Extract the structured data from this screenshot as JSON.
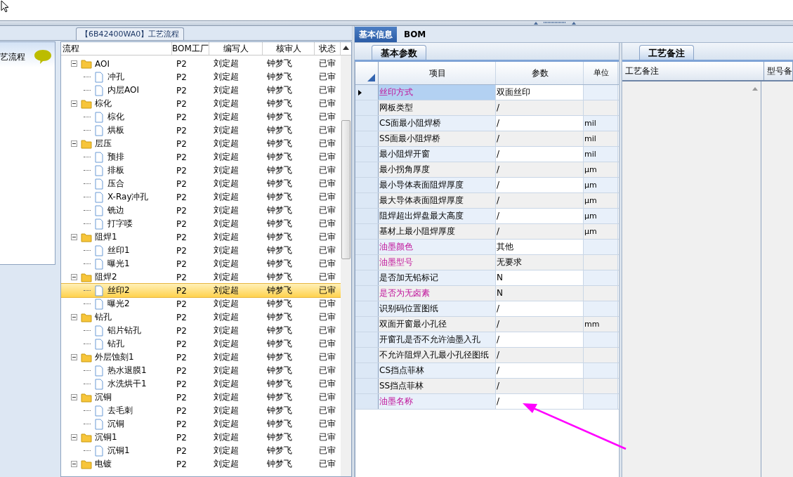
{
  "side_panel": {
    "title": "艺流程"
  },
  "process_tree": {
    "title": "【6B42400WA0】工艺流程",
    "columns": [
      "流程",
      "BOM工厂",
      "编写人",
      "核审人",
      "状态"
    ],
    "rows": [
      {
        "name": "AOI",
        "kind": "folder",
        "expanded": true,
        "bom_factory": "P2",
        "writer": "刘定超",
        "reviewer": "钟梦飞",
        "status": "已审",
        "selected": false,
        "children": [
          {
            "name": "冲孔",
            "kind": "file",
            "bom_factory": "P2",
            "writer": "刘定超",
            "reviewer": "钟梦飞",
            "status": "已审",
            "selected": false
          },
          {
            "name": "内层AOI",
            "kind": "file",
            "bom_factory": "P2",
            "writer": "刘定超",
            "reviewer": "钟梦飞",
            "status": "已审",
            "selected": false
          }
        ]
      },
      {
        "name": "棕化",
        "kind": "folder",
        "expanded": true,
        "bom_factory": "P2",
        "writer": "刘定超",
        "reviewer": "钟梦飞",
        "status": "已审",
        "selected": false,
        "children": [
          {
            "name": "棕化",
            "kind": "file",
            "bom_factory": "P2",
            "writer": "刘定超",
            "reviewer": "钟梦飞",
            "status": "已审",
            "selected": false
          },
          {
            "name": "烘板",
            "kind": "file",
            "bom_factory": "P2",
            "writer": "刘定超",
            "reviewer": "钟梦飞",
            "status": "已审",
            "selected": false
          }
        ]
      },
      {
        "name": "层压",
        "kind": "folder",
        "expanded": true,
        "bom_factory": "P2",
        "writer": "刘定超",
        "reviewer": "钟梦飞",
        "status": "已审",
        "selected": false,
        "children": [
          {
            "name": "预排",
            "kind": "file",
            "bom_factory": "P2",
            "writer": "刘定超",
            "reviewer": "钟梦飞",
            "status": "已审",
            "selected": false
          },
          {
            "name": "排板",
            "kind": "file",
            "bom_factory": "P2",
            "writer": "刘定超",
            "reviewer": "钟梦飞",
            "status": "已审",
            "selected": false
          },
          {
            "name": "压合",
            "kind": "file",
            "bom_factory": "P2",
            "writer": "刘定超",
            "reviewer": "钟梦飞",
            "status": "已审",
            "selected": false
          },
          {
            "name": "X-Ray冲孔",
            "kind": "file",
            "bom_factory": "P2",
            "writer": "刘定超",
            "reviewer": "钟梦飞",
            "status": "已审",
            "selected": false
          },
          {
            "name": "铣边",
            "kind": "file",
            "bom_factory": "P2",
            "writer": "刘定超",
            "reviewer": "钟梦飞",
            "status": "已审",
            "selected": false
          },
          {
            "name": "打字喽",
            "kind": "file",
            "bom_factory": "P2",
            "writer": "刘定超",
            "reviewer": "钟梦飞",
            "status": "已审",
            "selected": false
          }
        ]
      },
      {
        "name": "阻焊1",
        "kind": "folder",
        "expanded": true,
        "bom_factory": "P2",
        "writer": "刘定超",
        "reviewer": "钟梦飞",
        "status": "已审",
        "selected": false,
        "children": [
          {
            "name": "丝印1",
            "kind": "file",
            "bom_factory": "P2",
            "writer": "刘定超",
            "reviewer": "钟梦飞",
            "status": "已审",
            "selected": false
          },
          {
            "name": "曝光1",
            "kind": "file",
            "bom_factory": "P2",
            "writer": "刘定超",
            "reviewer": "钟梦飞",
            "status": "已审",
            "selected": false
          }
        ]
      },
      {
        "name": "阻焊2",
        "kind": "folder",
        "expanded": true,
        "bom_factory": "P2",
        "writer": "刘定超",
        "reviewer": "钟梦飞",
        "status": "已审",
        "selected": false,
        "children": [
          {
            "name": "丝印2",
            "kind": "file",
            "bom_factory": "P2",
            "writer": "刘定超",
            "reviewer": "钟梦飞",
            "status": "已审",
            "selected": true
          },
          {
            "name": "曝光2",
            "kind": "file",
            "bom_factory": "P2",
            "writer": "刘定超",
            "reviewer": "钟梦飞",
            "status": "已审",
            "selected": false
          }
        ]
      },
      {
        "name": "钻孔",
        "kind": "folder",
        "expanded": true,
        "bom_factory": "P2",
        "writer": "刘定超",
        "reviewer": "钟梦飞",
        "status": "已审",
        "selected": false,
        "children": [
          {
            "name": "铝片钻孔",
            "kind": "file",
            "bom_factory": "P2",
            "writer": "刘定超",
            "reviewer": "钟梦飞",
            "status": "已审",
            "selected": false
          },
          {
            "name": "钻孔",
            "kind": "file",
            "bom_factory": "P2",
            "writer": "刘定超",
            "reviewer": "钟梦飞",
            "status": "已审",
            "selected": false
          }
        ]
      },
      {
        "name": "外层蚀刻1",
        "kind": "folder",
        "expanded": true,
        "bom_factory": "P2",
        "writer": "刘定超",
        "reviewer": "钟梦飞",
        "status": "已审",
        "selected": false,
        "children": [
          {
            "name": "热水退膜1",
            "kind": "file",
            "bom_factory": "P2",
            "writer": "刘定超",
            "reviewer": "钟梦飞",
            "status": "已审",
            "selected": false
          },
          {
            "name": "水洗烘干1",
            "kind": "file",
            "bom_factory": "P2",
            "writer": "刘定超",
            "reviewer": "钟梦飞",
            "status": "已审",
            "selected": false
          }
        ]
      },
      {
        "name": "沉铜",
        "kind": "folder",
        "expanded": true,
        "bom_factory": "P2",
        "writer": "刘定超",
        "reviewer": "钟梦飞",
        "status": "已审",
        "selected": false,
        "children": [
          {
            "name": "去毛刺",
            "kind": "file",
            "bom_factory": "P2",
            "writer": "刘定超",
            "reviewer": "钟梦飞",
            "status": "已审",
            "selected": false
          },
          {
            "name": "沉铜",
            "kind": "file",
            "bom_factory": "P2",
            "writer": "刘定超",
            "reviewer": "钟梦飞",
            "status": "已审",
            "selected": false
          }
        ]
      },
      {
        "name": "沉铜1",
        "kind": "folder",
        "expanded": true,
        "bom_factory": "P2",
        "writer": "刘定超",
        "reviewer": "钟梦飞",
        "status": "已审",
        "selected": false,
        "children": [
          {
            "name": "沉铜1",
            "kind": "file",
            "bom_factory": "P2",
            "writer": "刘定超",
            "reviewer": "钟梦飞",
            "status": "已审",
            "selected": false
          }
        ]
      },
      {
        "name": "电镀",
        "kind": "folder",
        "expanded": true,
        "bom_factory": "P2",
        "writer": "刘定超",
        "reviewer": "钟梦飞",
        "status": "已审",
        "selected": false
      }
    ]
  },
  "info_tabs": [
    {
      "label": "基本信息",
      "selected": true
    },
    {
      "label": "BOM",
      "selected": false
    }
  ],
  "parameters": {
    "tab": "基本参数",
    "columns": [
      "项目",
      "参数",
      "单位"
    ],
    "rows": [
      {
        "item": "丝印方式",
        "value": "双面丝印",
        "highlighted": true,
        "selected": true
      },
      {
        "item": "网板类型",
        "value": "/",
        "highlighted": false,
        "selected": false
      },
      {
        "item": "CS面最小阻焊桥",
        "value": "/",
        "unit": "mil",
        "highlighted": false,
        "selected": false
      },
      {
        "item": "SS面最小阻焊桥",
        "value": "/",
        "unit": "mil",
        "highlighted": false,
        "selected": false
      },
      {
        "item": "最小阻焊开窗",
        "value": "/",
        "unit": "mil",
        "highlighted": false,
        "selected": false
      },
      {
        "item": "最小拐角厚度",
        "value": "/",
        "unit": "μm",
        "highlighted": false,
        "selected": false
      },
      {
        "item": "最小导体表面阻焊厚度",
        "value": "/",
        "unit": "μm",
        "highlighted": false,
        "selected": false
      },
      {
        "item": "最大导体表面阻焊厚度",
        "value": "/",
        "unit": "μm",
        "highlighted": false,
        "selected": false
      },
      {
        "item": "阻焊超出焊盘最大高度",
        "value": "/",
        "unit": "μm",
        "highlighted": false,
        "selected": false
      },
      {
        "item": "基材上最小阻焊厚度",
        "value": "/",
        "unit": "μm",
        "highlighted": false,
        "selected": false
      },
      {
        "item": "油墨颜色",
        "value": "其他",
        "highlighted": true,
        "selected": false
      },
      {
        "item": "油墨型号",
        "value": "无要求",
        "highlighted": true,
        "selected": false
      },
      {
        "item": "是否加无铅标记",
        "value": "N",
        "highlighted": false,
        "selected": false
      },
      {
        "item": "是否为无卤素",
        "value": "N",
        "highlighted": true,
        "selected": false
      },
      {
        "item": "识别码位置图纸",
        "value": "/",
        "highlighted": false,
        "selected": false
      },
      {
        "item": "双面开窗最小孔径",
        "value": "/",
        "unit": "mm",
        "highlighted": false,
        "selected": false
      },
      {
        "item": "开窗孔是否不允许油墨入孔",
        "value": "/",
        "highlighted": false,
        "selected": false
      },
      {
        "item": "不允许阻焊入孔最小孔径图纸",
        "value": "/",
        "highlighted": false,
        "selected": false
      },
      {
        "item": "CS挡点菲林",
        "value": "/",
        "highlighted": false,
        "selected": false
      },
      {
        "item": "SS挡点菲林",
        "value": "/",
        "highlighted": false,
        "selected": false
      },
      {
        "item": "油墨名称",
        "value": "/",
        "highlighted": true,
        "selected": false
      }
    ]
  },
  "notes": {
    "tab": "工艺备注",
    "columns": [
      "工艺备注",
      "型号备"
    ]
  }
}
